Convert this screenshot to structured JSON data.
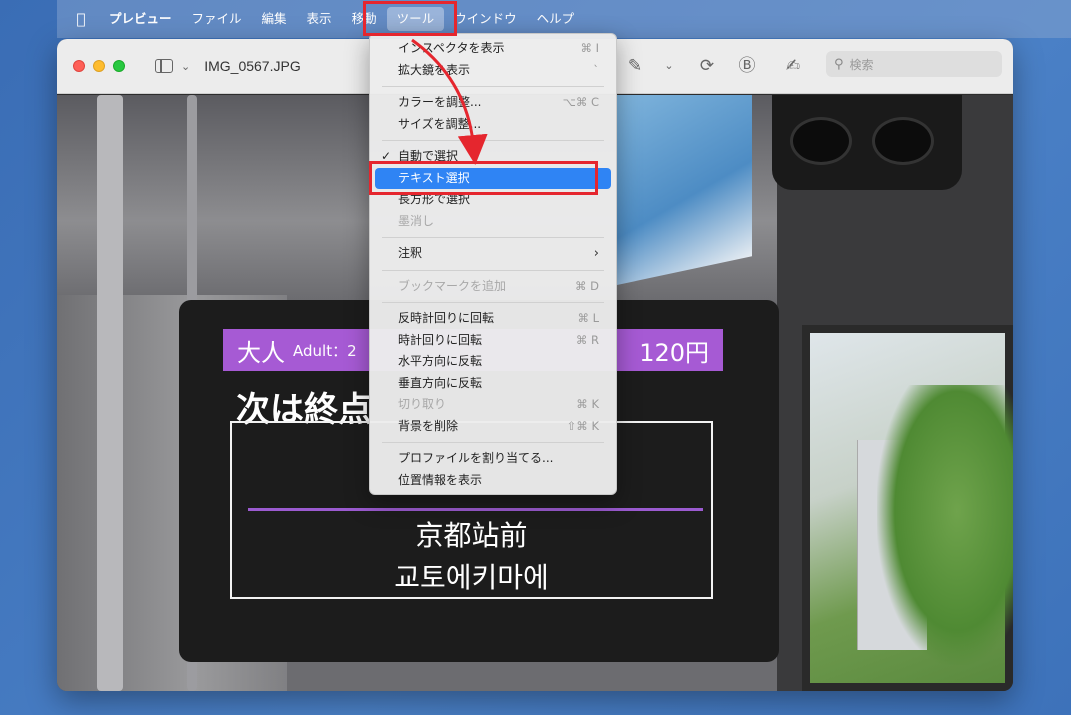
{
  "menubar": {
    "app_name": "プレビュー",
    "items": [
      "ファイル",
      "編集",
      "表示",
      "移動",
      "ツール",
      "ウインドウ",
      "ヘルプ"
    ],
    "active_item": "ツール"
  },
  "window": {
    "title": "IMG_0567.JPG",
    "search_placeholder": "検索"
  },
  "tools_menu": {
    "items": [
      {
        "label": "インスペクタを表示",
        "shortcut": "⌘ I",
        "enabled": true
      },
      {
        "label": "拡大鏡を表示",
        "shortcut": "`",
        "enabled": true
      },
      {
        "label": "カラーを調整...",
        "shortcut": "⌥⌘ C",
        "enabled": true
      },
      {
        "label": "サイズを調整...",
        "shortcut": "",
        "enabled": true
      },
      {
        "label": "自動で選択",
        "shortcut": "",
        "enabled": true,
        "checked": true
      },
      {
        "label": "テキスト選択",
        "shortcut": "",
        "enabled": true,
        "selected": true
      },
      {
        "label": "長方形で選択",
        "shortcut": "",
        "enabled": true
      },
      {
        "label": "墨消し",
        "shortcut": "",
        "enabled": false
      },
      {
        "label": "注釈",
        "shortcut": "",
        "enabled": true,
        "submenu": true
      },
      {
        "label": "ブックマークを追加",
        "shortcut": "⌘ D",
        "enabled": false
      },
      {
        "label": "反時計回りに回転",
        "shortcut": "⌘ L",
        "enabled": true
      },
      {
        "label": "時計回りに回転",
        "shortcut": "⌘ R",
        "enabled": true
      },
      {
        "label": "水平方向に反転",
        "shortcut": "",
        "enabled": true
      },
      {
        "label": "垂直方向に反転",
        "shortcut": "",
        "enabled": true
      },
      {
        "label": "切り取り",
        "shortcut": "⌘ K",
        "enabled": false
      },
      {
        "label": "背景を削除",
        "shortcut": "⇧⌘ K",
        "enabled": true
      },
      {
        "label": "プロファイルを割り当てる...",
        "shortcut": "",
        "enabled": true
      },
      {
        "label": "位置情報を表示",
        "shortcut": "",
        "enabled": true
      }
    ]
  },
  "photo": {
    "fare_bar_left": "大人",
    "fare_bar_adult": "Adult：2",
    "fare_bar_right": "120円",
    "next_stop_label": "次は終点",
    "station_jp": "京都站前",
    "station_kr": "교토에키마에"
  },
  "colors": {
    "highlight": "#e5262e",
    "menu_selection": "#2f84f4",
    "display_bar": "#a65ad4"
  }
}
